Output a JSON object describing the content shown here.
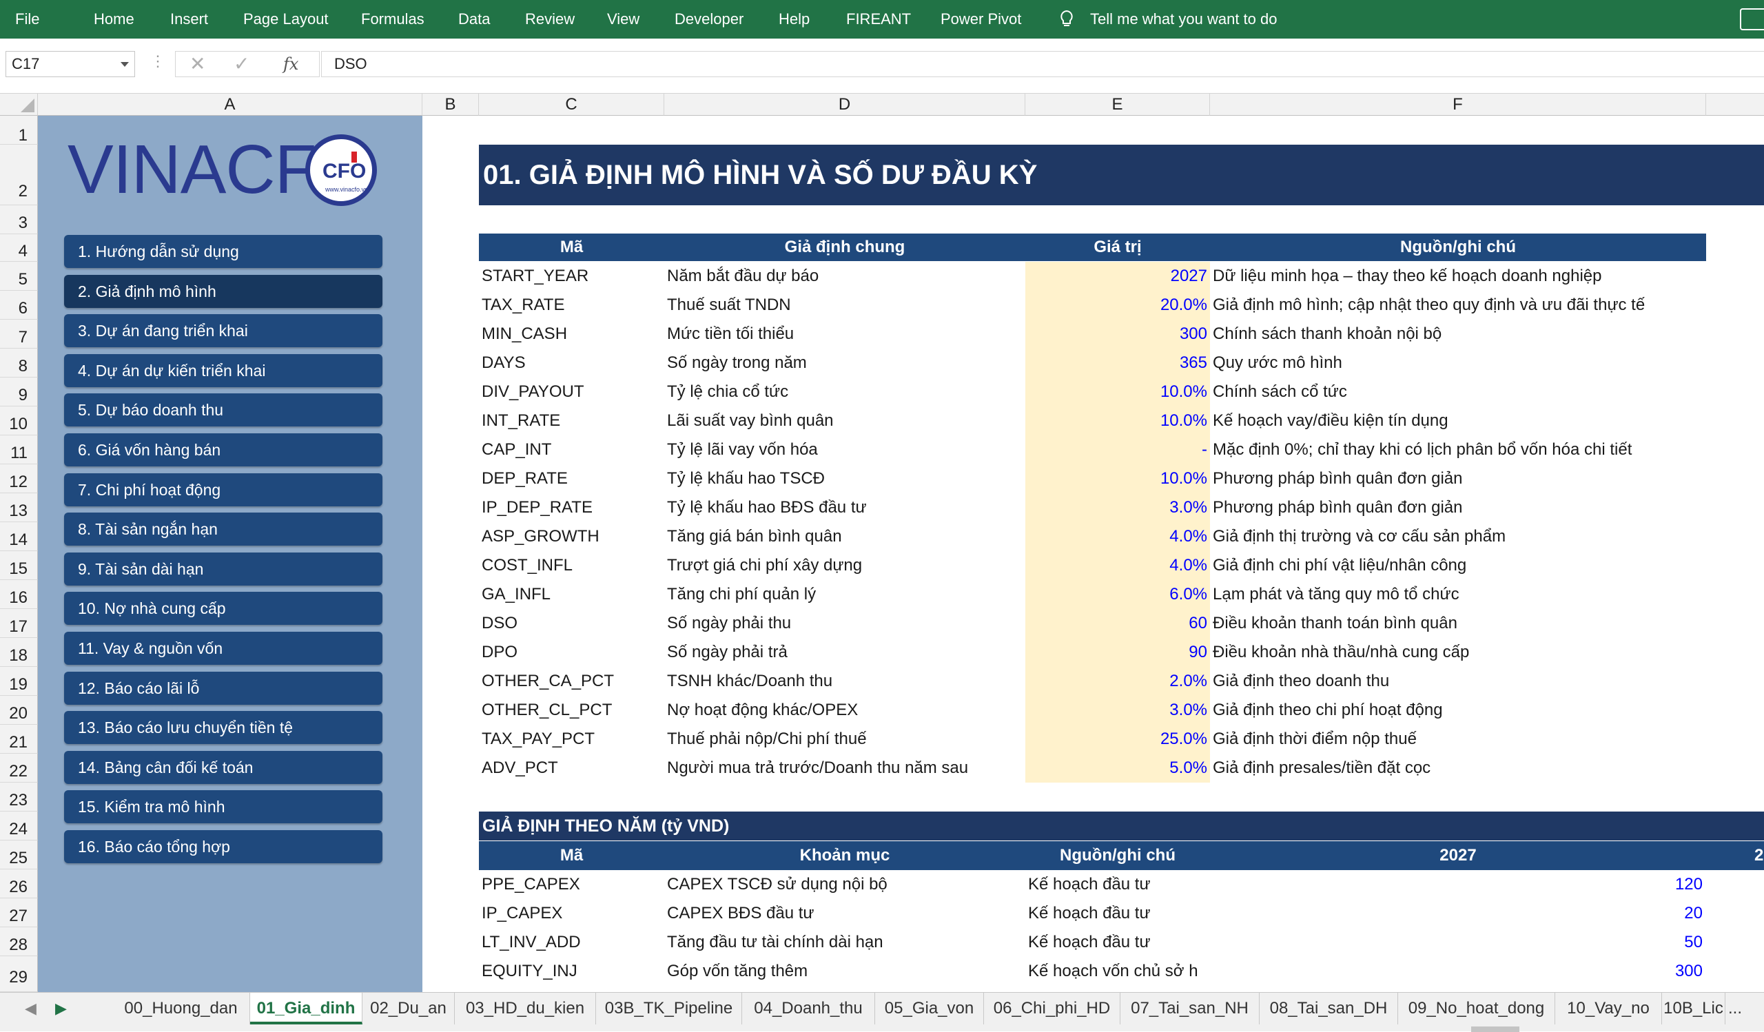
{
  "ribbon": {
    "tabs": [
      "File",
      "Home",
      "Insert",
      "Page Layout",
      "Formulas",
      "Data",
      "Review",
      "View",
      "Developer",
      "Help",
      "FIREANT",
      "Power Pivot"
    ],
    "tell_me": "Tell me what you want to do",
    "color": "#217346"
  },
  "formula_bar": {
    "name_box": "C17",
    "cancel_icon": "✕",
    "enter_icon": "✓",
    "fx_label": "fx",
    "content": "DSO"
  },
  "columns": [
    "A",
    "B",
    "C",
    "D",
    "E",
    "F"
  ],
  "rows": [
    "1",
    "2",
    "3",
    "4",
    "5",
    "6",
    "7",
    "8",
    "9",
    "10",
    "11",
    "12",
    "13",
    "14",
    "15",
    "16",
    "17",
    "18",
    "19",
    "20",
    "21",
    "22",
    "23",
    "24",
    "25",
    "26",
    "27",
    "28",
    "29"
  ],
  "sidebar": {
    "logo_text": "VINACF",
    "logo_badge": "CFO",
    "logo_url": "www.vinacfo.vn",
    "items": [
      "1. Hướng dẫn sử dụng",
      "2. Giả định mô hình",
      "3. Dự án đang triển khai",
      "4. Dự án dự kiến triển khai",
      "5. Dự báo doanh thu",
      "6. Giá vốn hàng bán",
      "7. Chi phí hoạt động",
      "8. Tài sản ngắn hạn",
      "9. Tài sản dài hạn",
      "10. Nợ nhà cung cấp",
      "11. Vay & nguồn vốn",
      "12. Báo cáo lãi lỗ",
      "13. Báo cáo lưu chuyển tiền tệ",
      "14. Bảng cân đối kế toán",
      "15. Kiểm tra mô hình",
      "16. Báo cáo tổng hợp"
    ],
    "active_index": 1
  },
  "sheet": {
    "title": "01. GIẢ ĐỊNH MÔ HÌNH VÀ SỐ DƯ ĐẦU KỲ",
    "table1": {
      "headers": [
        "Mã",
        "Giả định chung",
        "Giá trị",
        "Nguồn/ghi chú"
      ],
      "rows": [
        {
          "code": "START_YEAR",
          "desc": "Năm bắt đầu dự báo",
          "value": "2027",
          "note": "Dữ liệu minh họa – thay theo kế hoạch doanh nghiệp"
        },
        {
          "code": "TAX_RATE",
          "desc": "Thuế suất TNDN",
          "value": "20.0%",
          "note": "Giả định mô hình; cập nhật theo quy định và ưu đãi thực tế"
        },
        {
          "code": "MIN_CASH",
          "desc": "Mức tiền tối thiểu",
          "value": "300",
          "note": "Chính sách thanh khoản nội bộ"
        },
        {
          "code": "DAYS",
          "desc": "Số ngày trong năm",
          "value": "365",
          "note": "Quy ước mô hình"
        },
        {
          "code": "DIV_PAYOUT",
          "desc": "Tỷ lệ chia cổ tức",
          "value": "10.0%",
          "note": "Chính sách cổ tức"
        },
        {
          "code": "INT_RATE",
          "desc": "Lãi suất vay bình quân",
          "value": "10.0%",
          "note": "Kế hoạch vay/điều kiện tín dụng"
        },
        {
          "code": "CAP_INT",
          "desc": "Tỷ lệ lãi vay vốn hóa",
          "value": "-",
          "note": "Mặc định 0%; chỉ thay khi có lịch phân bổ vốn hóa chi tiết"
        },
        {
          "code": "DEP_RATE",
          "desc": "Tỷ lệ khấu hao TSCĐ",
          "value": "10.0%",
          "note": "Phương pháp bình quân đơn giản"
        },
        {
          "code": "IP_DEP_RATE",
          "desc": "Tỷ lệ khấu hao BĐS đầu tư",
          "value": "3.0%",
          "note": "Phương pháp bình quân đơn giản"
        },
        {
          "code": "ASP_GROWTH",
          "desc": "Tăng giá bán bình quân",
          "value": "4.0%",
          "note": "Giả định thị trường và cơ cấu sản phẩm"
        },
        {
          "code": "COST_INFL",
          "desc": "Trượt giá chi phí xây dựng",
          "value": "4.0%",
          "note": "Giả định chi phí vật liệu/nhân công"
        },
        {
          "code": "GA_INFL",
          "desc": "Tăng chi phí quản lý",
          "value": "6.0%",
          "note": "Lạm phát và tăng quy mô tổ chức"
        },
        {
          "code": "DSO",
          "desc": "Số ngày phải thu",
          "value": "60",
          "note": "Điều khoản thanh toán bình quân"
        },
        {
          "code": "DPO",
          "desc": "Số ngày phải trả",
          "value": "90",
          "note": "Điều khoản nhà thầu/nhà cung cấp"
        },
        {
          "code": "OTHER_CA_PCT",
          "desc": "TSNH khác/Doanh thu",
          "value": "2.0%",
          "note": "Giả định theo doanh thu"
        },
        {
          "code": "OTHER_CL_PCT",
          "desc": "Nợ hoạt động khác/OPEX",
          "value": "3.0%",
          "note": "Giả định theo chi phí hoạt động"
        },
        {
          "code": "TAX_PAY_PCT",
          "desc": "Thuế phải nộp/Chi phí thuế",
          "value": "25.0%",
          "note": "Giả định thời điểm nộp thuế"
        },
        {
          "code": "ADV_PCT",
          "desc": "Người mua trả trước/Doanh thu năm sau",
          "value": "5.0%",
          "note": "Giả định presales/tiền đặt cọc"
        }
      ]
    },
    "section2_title": "GIẢ ĐỊNH THEO NĂM (tỷ VND)",
    "table2": {
      "headers": [
        "Mã",
        "Khoản mục",
        "Nguồn/ghi chú",
        "2027",
        "2"
      ],
      "rows": [
        {
          "code": "PPE_CAPEX",
          "item": "CAPEX TSCĐ sử dụng nội bộ",
          "note": "Kế hoạch đầu tư",
          "y2027": "120"
        },
        {
          "code": "IP_CAPEX",
          "item": "CAPEX BĐS đầu tư",
          "note": "Kế hoạch đầu tư",
          "y2027": "20"
        },
        {
          "code": "LT_INV_ADD",
          "item": "Tăng đầu tư tài chính dài hạn",
          "note": "Kế hoạch đầu tư",
          "y2027": "50"
        },
        {
          "code": "EQUITY_INJ",
          "item": "Góp vốn tăng thêm",
          "note": "Kế hoạch vốn chủ sở h",
          "y2027": "300"
        }
      ]
    }
  },
  "sheet_tabs": {
    "tabs": [
      "00_Huong_dan",
      "01_Gia_dinh",
      "02_Du_an",
      "03_HD_du_kien",
      "03B_TK_Pipeline",
      "04_Doanh_thu",
      "05_Gia_von",
      "06_Chi_phi_HD",
      "07_Tai_san_NH",
      "08_Tai_san_DH",
      "09_No_hoat_dong",
      "10_Vay_no",
      "10B_Lic"
    ],
    "active_index": 1,
    "more": "..."
  },
  "colors": {
    "excel_green": "#217346",
    "sidebar_bg": "#8da9c8",
    "nav_button": "#1f497d",
    "title_band": "#1f3864",
    "input_fill": "#fff2cc",
    "input_font": "#0000ff"
  }
}
